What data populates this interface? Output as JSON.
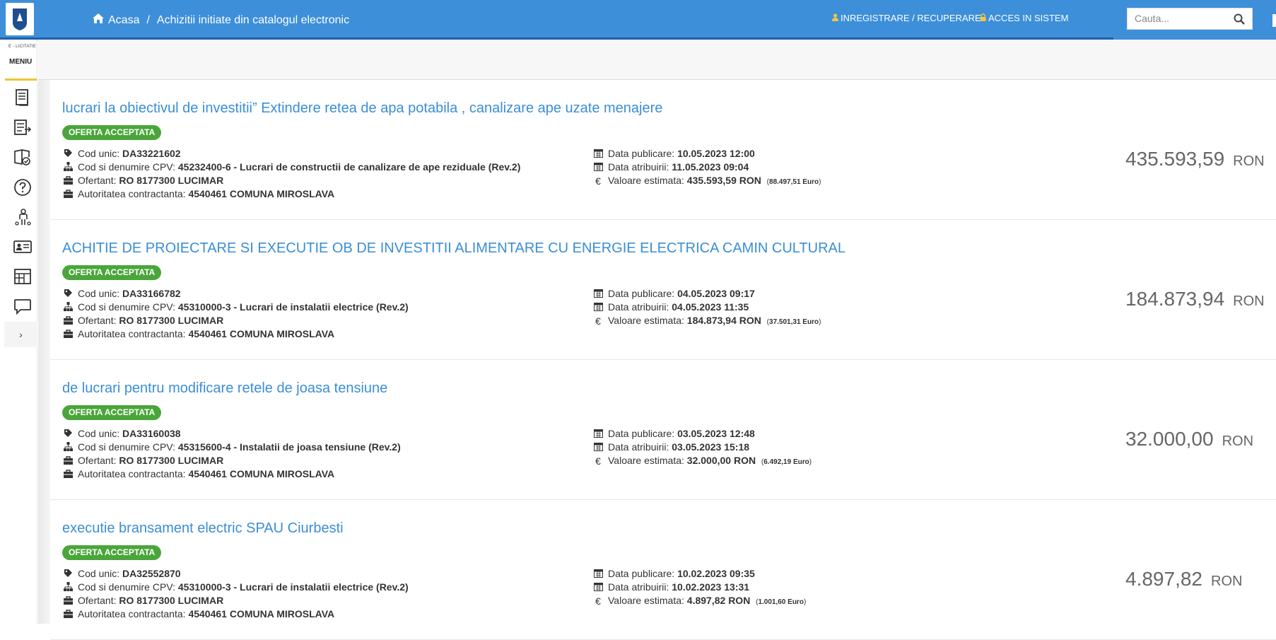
{
  "header": {
    "breadcrumb_home": "Acasa",
    "breadcrumb_sep": "/",
    "breadcrumb_current": "Achizitii initiate din catalogul electronic",
    "register_label": "INREGISTRARE / RECUPERARE",
    "login_label": "ACCES IN SISTEM",
    "search_placeholder": "Cauta..."
  },
  "sidebar": {
    "brand_small": "E - LICITATIE",
    "menu_label": "MENIU",
    "expand_label": "›",
    "icons": [
      "document-icon",
      "list-export-icon",
      "checklist-book-icon",
      "help-circle-icon",
      "person-tree-icon",
      "id-card-icon",
      "catalog-icon",
      "chat-icon"
    ]
  },
  "labels": {
    "cod_unic": "Cod unic:",
    "cpv": "Cod si denumire CPV:",
    "ofertant": "Ofertant:",
    "autoritate": "Autoritatea contractanta:",
    "data_publicare": "Data publicare:",
    "data_atribuirii": "Data atribuirii:",
    "valoare_estimata": "Valoare estimata:",
    "ron": "RON",
    "euro": "Euro"
  },
  "items": [
    {
      "title": "lucrari la obiectivul de investitii” Extindere retea de apa potabila , canalizare ape uzate menajere",
      "status": "OFERTA ACCEPTATA",
      "cod_unic": "DA33221602",
      "cpv": "45232400-6 - Lucrari de constructii de canalizare de ape reziduale (Rev.2)",
      "ofertant": "RO 8177300 LUCIMAR",
      "autoritate": "4540461 COMUNA MIROSLAVA",
      "data_publicare": "10.05.2023 12:00",
      "data_atribuirii": "11.05.2023 09:04",
      "valoare": "435.593,59",
      "valoare_euro": "88.497,51",
      "price": "435.593,59",
      "currency": "RON"
    },
    {
      "title": "ACHITIE DE PROIECTARE SI EXECUTIE OB DE INVESTITII ALIMENTARE CU ENERGIE ELECTRICA CAMIN CULTURAL",
      "status": "OFERTA ACCEPTATA",
      "cod_unic": "DA33166782",
      "cpv": "45310000-3 - Lucrari de instalatii electrice (Rev.2)",
      "ofertant": "RO 8177300 LUCIMAR",
      "autoritate": "4540461 COMUNA MIROSLAVA",
      "data_publicare": "04.05.2023 09:17",
      "data_atribuirii": "04.05.2023 11:35",
      "valoare": "184.873,94",
      "valoare_euro": "37.501,31",
      "price": "184.873,94",
      "currency": "RON"
    },
    {
      "title": "de lucrari pentru modificare retele de joasa tensiune",
      "status": "OFERTA ACCEPTATA",
      "cod_unic": "DA33160038",
      "cpv": "45315600-4 - Instalatii de joasa tensiune (Rev.2)",
      "ofertant": "RO 8177300 LUCIMAR",
      "autoritate": "4540461 COMUNA MIROSLAVA",
      "data_publicare": "03.05.2023 12:48",
      "data_atribuirii": "03.05.2023 15:18",
      "valoare": "32.000,00",
      "valoare_euro": "6.492,19",
      "price": "32.000,00",
      "currency": "RON"
    },
    {
      "title": "executie bransament electric SPAU Ciurbesti",
      "status": "OFERTA ACCEPTATA",
      "cod_unic": "DA32552870",
      "cpv": "45310000-3 - Lucrari de instalatii electrice (Rev.2)",
      "ofertant": "RO 8177300 LUCIMAR",
      "autoritate": "4540461 COMUNA MIROSLAVA",
      "data_publicare": "10.02.2023 09:35",
      "data_atribuirii": "10.02.2023 13:31",
      "valoare": "4.897,82",
      "valoare_euro": "1.001,60",
      "price": "4.897,82",
      "currency": "RON"
    }
  ],
  "colors": {
    "header_bg": "#3d8fd9",
    "title_link": "#3a8ed6",
    "badge_green": "#4aa63a",
    "menu_accent": "#f1c232"
  }
}
